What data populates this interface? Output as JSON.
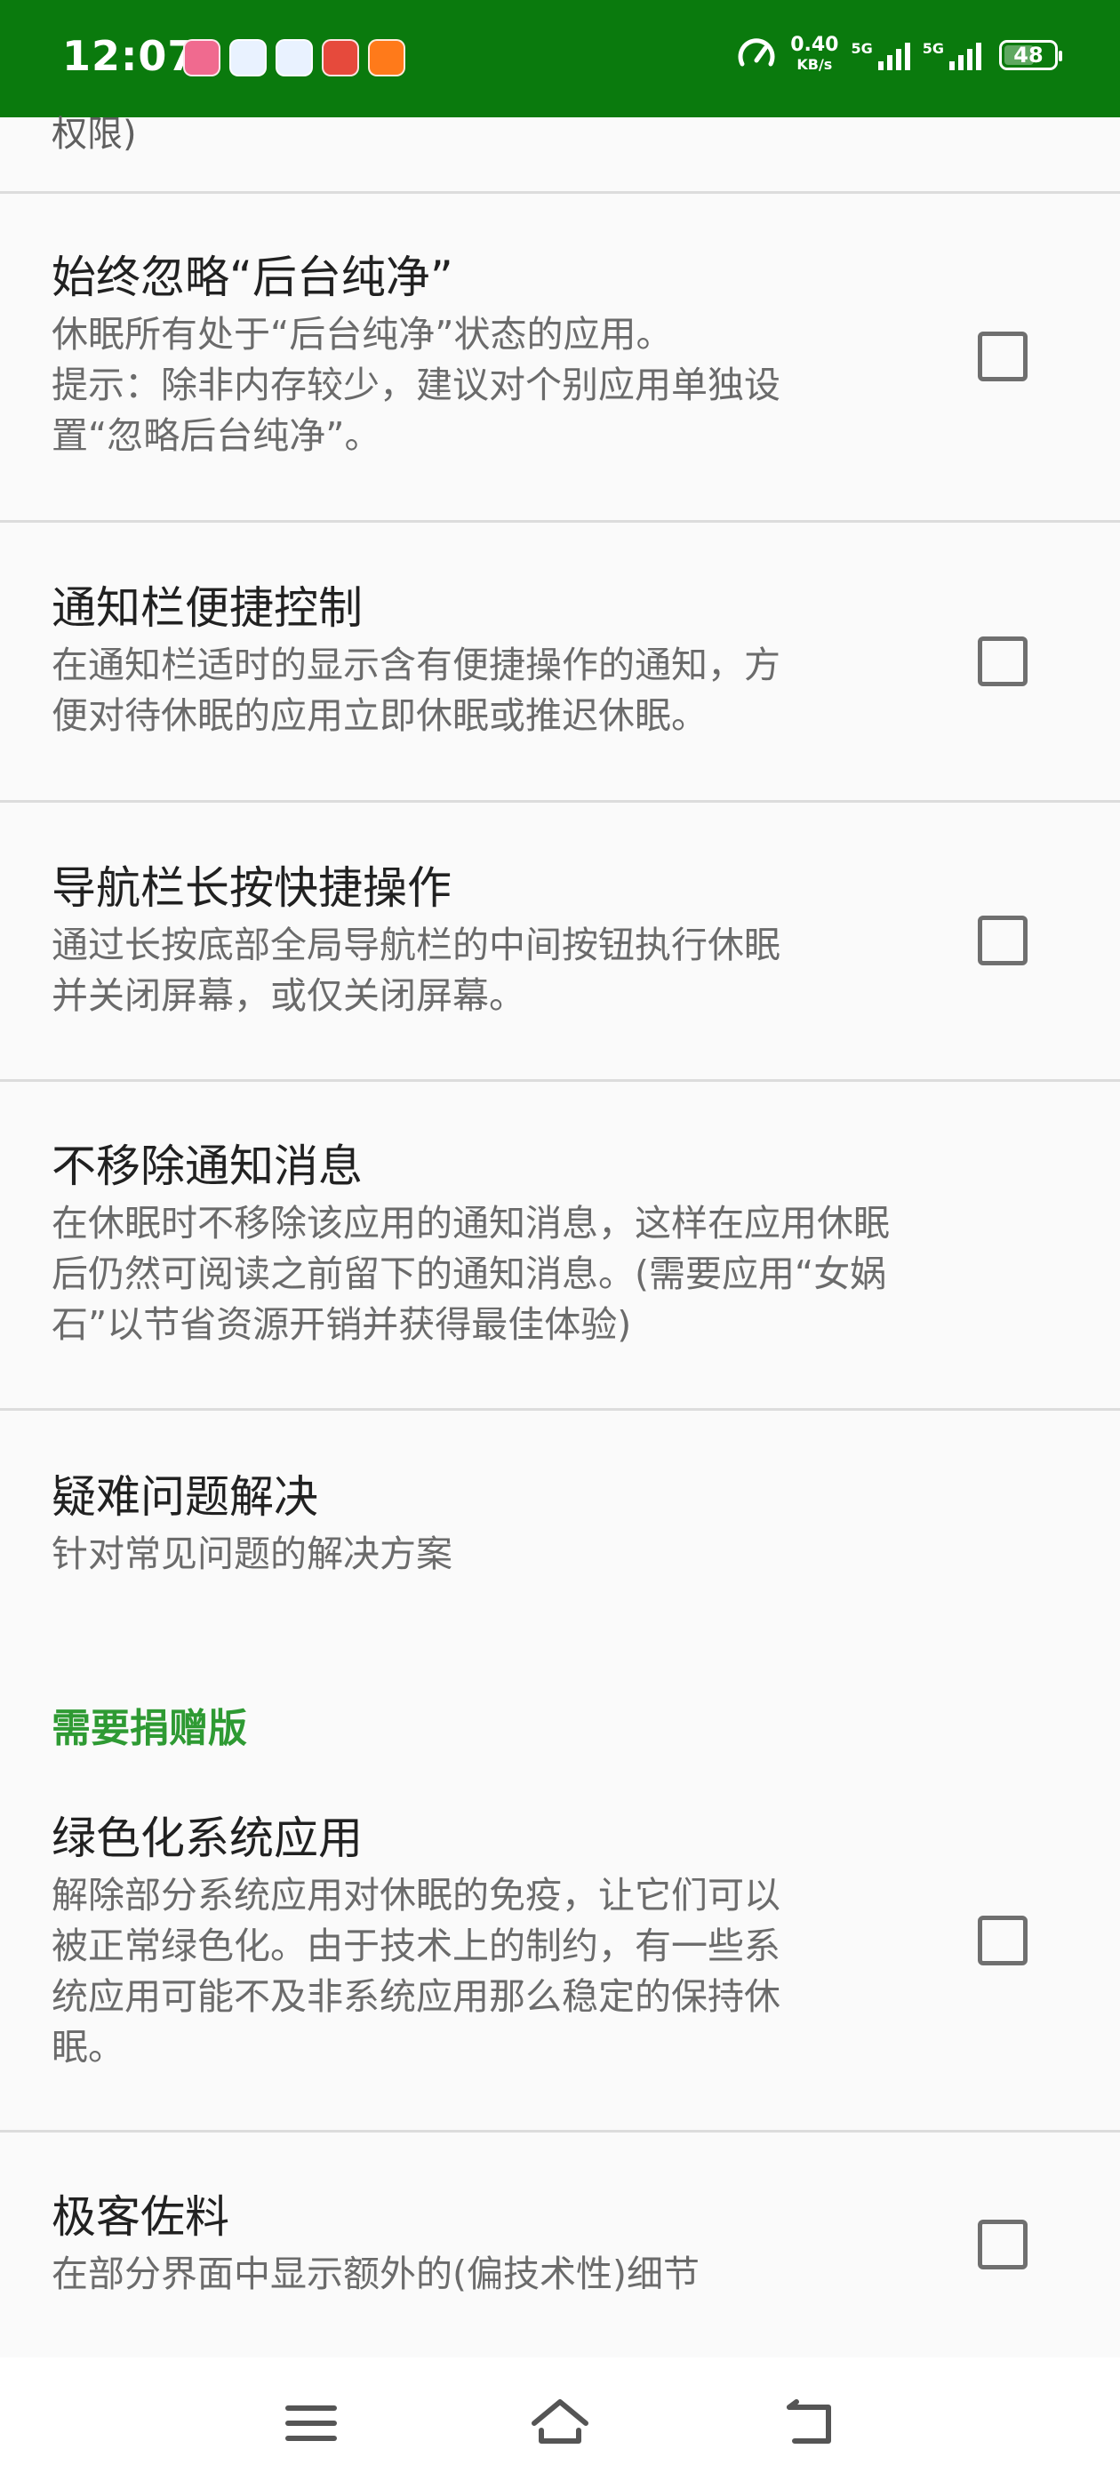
{
  "status_bar": {
    "time": "12:07",
    "net_speed_value": "0.40",
    "net_speed_unit": "KB/s",
    "signal1_label": "5G",
    "signal2_label": "5G",
    "battery_level": "48",
    "app_icons": [
      "bilibili-app-icon",
      "baidu-netdisk-app-icon",
      "baidu-netdisk-app-icon",
      "game-app-icon",
      "orange-app-icon"
    ]
  },
  "peek_text": "权限)",
  "preferences": [
    {
      "title": "始终忽略“后台纯净”",
      "summary": "休眠所有处于“后台纯净”状态的应用。\n提示：除非内存较少，建议对个别应用单独设\n置“忽略后台纯净”。",
      "checked": false
    },
    {
      "title": "通知栏便捷控制",
      "summary": "在通知栏适时的显示含有便捷操作的通知，方\n便对待休眠的应用立即休眠或推迟休眠。",
      "checked": false
    },
    {
      "title": "导航栏长按快捷操作",
      "summary": "通过长按底部全局导航栏的中间按钮执行休眠\n并关闭屏幕，或仅关闭屏幕。",
      "checked": false
    },
    {
      "title": "不移除通知消息",
      "summary": "在休眠时不移除该应用的通知消息，这样在应用休眠\n后仍然可阅读之前留下的通知消息。(需要应用“女娲\n石”以节省资源开销并获得最佳体验)"
    },
    {
      "title": "疑难问题解决",
      "summary": "针对常见问题的解决方案"
    },
    {
      "title": "绿色化系统应用",
      "summary": "解除部分系统应用对休眠的免疫，让它们可以\n被正常绿色化。由于技术上的制约，有一些系\n统应用可能不及非系统应用那么稳定的保持休\n眠。",
      "checked": false
    },
    {
      "title": "极客佐料",
      "summary": "在部分界面中显示额外的(偏技术性)细节",
      "checked": false
    }
  ],
  "category_header": "需要捐赠版",
  "colors": {
    "status_bar_bg": "#0a7a0d",
    "accent_green": "#2e9a33",
    "background": "#fafafa"
  },
  "nav_bar": {
    "icons": [
      "menu-icon",
      "home-icon",
      "back-icon"
    ]
  }
}
